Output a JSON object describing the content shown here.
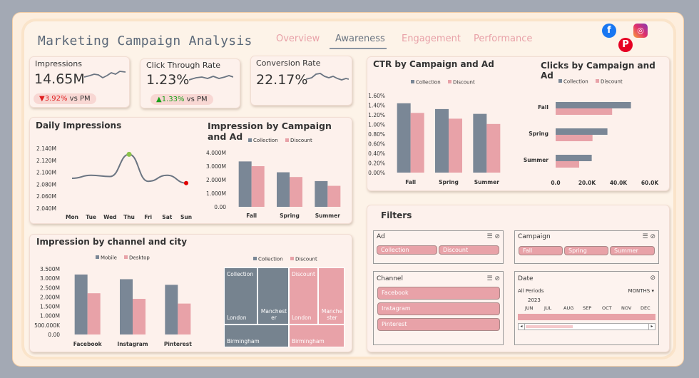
{
  "app": {
    "title": "Marketing Campaign Analysis"
  },
  "nav": {
    "tabs": [
      "Overview",
      "Awareness",
      "Engagement",
      "Performance"
    ],
    "active": "Awareness"
  },
  "social": {
    "facebook": "f",
    "instagram": "◎",
    "pinterest": "P"
  },
  "colors": {
    "collection": "#7a8796",
    "discount": "#e8a2a8",
    "mobile": "#7a8796",
    "desktop": "#e8a2a8"
  },
  "kpi": {
    "impressions": {
      "label": "Impressions",
      "value": "14.65M",
      "delta": "3.92%",
      "delta_dir": "down",
      "vs": "vs PM"
    },
    "ctr": {
      "label": "Click Through Rate",
      "value": "1.23%",
      "delta": "1.33%",
      "delta_dir": "up",
      "vs": "vs PM"
    },
    "conversion": {
      "label": "Conversion Rate",
      "value": "22.17%"
    }
  },
  "daily": {
    "title": "Daily Impressions",
    "yticks": [
      "2.140M",
      "2.120M",
      "2.100M",
      "2.080M",
      "2.060M",
      "2.040M"
    ],
    "xticks": [
      "Mon",
      "Tue",
      "Wed",
      "Thu",
      "Fri",
      "Sat",
      "Sun"
    ]
  },
  "imp_campaign": {
    "title": "Impression by Campaign and Ad",
    "legend": [
      "Collection",
      "Discount"
    ],
    "yticks": [
      "4.000M",
      "3.000M",
      "2.000M",
      "1.000M",
      "0.00"
    ],
    "categories": [
      "Fall",
      "Spring",
      "Summer"
    ]
  },
  "ctr_campaign": {
    "title": "CTR by Campaign and Ad",
    "legend": [
      "Collection",
      "Discount"
    ],
    "yticks": [
      "1.60%",
      "1.40%",
      "1.20%",
      "1.00%",
      "0.80%",
      "0.60%",
      "0.40%",
      "0.20%",
      "0.00%"
    ],
    "categories": [
      "Fall",
      "Spring",
      "Summer"
    ]
  },
  "clicks_campaign": {
    "title": "Clicks by Campaign and Ad",
    "legend": [
      "Collection",
      "Discount"
    ],
    "categories": [
      "Fall",
      "Spring",
      "Summer"
    ],
    "xticks": [
      "0.0",
      "20.0K",
      "40.0K",
      "60.0K"
    ]
  },
  "channel_city": {
    "title": "Impression by channel and city",
    "legend": [
      "Mobile",
      "Desktop"
    ],
    "yticks": [
      "3.500M",
      "3.000M",
      "2.500M",
      "2.000M",
      "1.500M",
      "1.000M",
      "500.000K",
      "0.00"
    ],
    "categories": [
      "Facebook",
      "Instagram",
      "Pinterest"
    ],
    "tm_legend": [
      "Collection",
      "Discount"
    ],
    "tm_labels": {
      "collection": "Collection",
      "discount": "Discount",
      "london": "London",
      "manchester": "Manchest er",
      "manchester2": "Manche ster",
      "birmingham": "Birmingham"
    }
  },
  "filters": {
    "title": "Filters",
    "ad": {
      "label": "Ad",
      "options": [
        "Collection",
        "Discount"
      ]
    },
    "campaign": {
      "label": "Campaign",
      "options": [
        "Fall",
        "Spring",
        "Summer"
      ]
    },
    "channel": {
      "label": "Channel",
      "options": [
        "Facebook",
        "Instagram",
        "Pinterest"
      ]
    },
    "date": {
      "label": "Date",
      "period": "All Periods",
      "granularity": "MONTHS",
      "year": "2023",
      "months": [
        "JUN",
        "JUL",
        "AUG",
        "SEP",
        "OCT",
        "NOV",
        "DEC"
      ]
    }
  },
  "chart_data": [
    {
      "type": "line",
      "title": "Daily Impressions",
      "x": [
        "Mon",
        "Tue",
        "Wed",
        "Thu",
        "Fri",
        "Sat",
        "Sun"
      ],
      "values": [
        2.09,
        2.095,
        2.093,
        2.13,
        2.085,
        2.095,
        2.082
      ],
      "unit": "M",
      "ylim": [
        2.04,
        2.14
      ]
    },
    {
      "type": "bar",
      "title": "Impression by Campaign and Ad",
      "categories": [
        "Fall",
        "Spring",
        "Summer"
      ],
      "series": [
        {
          "name": "Collection",
          "values": [
            3.35,
            2.55,
            1.9
          ]
        },
        {
          "name": "Discount",
          "values": [
            3.0,
            2.2,
            1.55
          ]
        }
      ],
      "unit": "M",
      "ylim": [
        0,
        4
      ]
    },
    {
      "type": "bar",
      "title": "CTR by Campaign and Ad",
      "categories": [
        "Fall",
        "Spring",
        "Summer"
      ],
      "series": [
        {
          "name": "Collection",
          "values": [
            1.44,
            1.32,
            1.22
          ]
        },
        {
          "name": "Discount",
          "values": [
            1.24,
            1.12,
            1.01
          ]
        }
      ],
      "unit": "%",
      "ylim": [
        0,
        1.6
      ]
    },
    {
      "type": "bar",
      "orientation": "horizontal",
      "title": "Clicks by Campaign and Ad",
      "categories": [
        "Fall",
        "Spring",
        "Summer"
      ],
      "series": [
        {
          "name": "Collection",
          "values": [
            48000,
            33000,
            23000
          ]
        },
        {
          "name": "Discount",
          "values": [
            36000,
            23500,
            15000
          ]
        }
      ],
      "xlim": [
        0,
        60000
      ]
    },
    {
      "type": "bar",
      "title": "Impression by channel and city",
      "categories": [
        "Facebook",
        "Instagram",
        "Pinterest"
      ],
      "series": [
        {
          "name": "Mobile",
          "values": [
            3.2,
            2.95,
            2.65
          ]
        },
        {
          "name": "Desktop",
          "values": [
            2.2,
            1.9,
            1.65
          ]
        }
      ],
      "unit": "M",
      "ylim": [
        0,
        3.5
      ]
    }
  ]
}
